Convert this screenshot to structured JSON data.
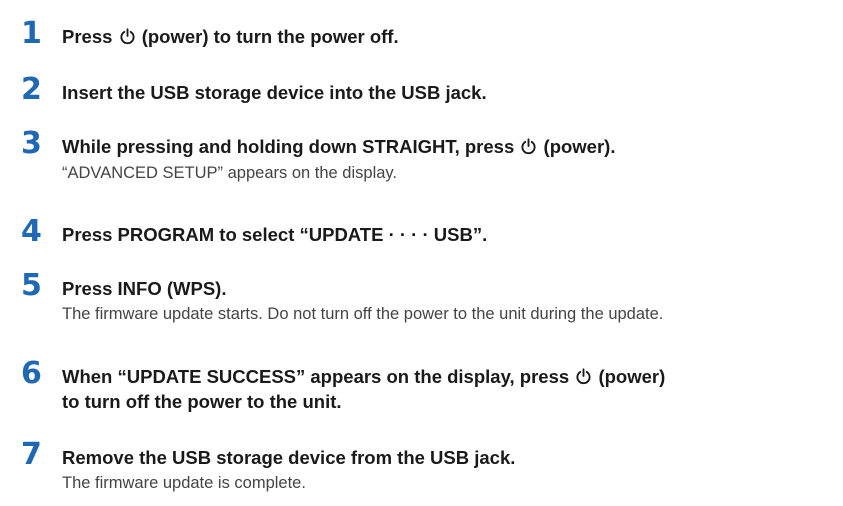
{
  "steps": [
    {
      "number": "1",
      "parts": [
        "Press ",
        "(power) to turn the power off."
      ]
    },
    {
      "number": "2",
      "title": "Insert the USB storage device into the USB jack."
    },
    {
      "number": "3",
      "parts": [
        "While pressing and holding down STRAIGHT, press ",
        "(power)."
      ],
      "description": "“ADVANCED SETUP” appears on the display."
    },
    {
      "number": "4",
      "title": "Press PROGRAM to select “UPDATE · · · · USB”."
    },
    {
      "number": "5",
      "title": "Press INFO (WPS).",
      "description": "The firmware update starts. Do not turn off the power to the unit during the update."
    },
    {
      "number": "6",
      "parts": [
        "When “UPDATE SUCCESS” appears on the display, press ",
        "(power)"
      ],
      "line2": "to turn off the power to the unit."
    },
    {
      "number": "7",
      "title": "Remove the USB storage device from the USB jack.",
      "description": "The firmware update is complete."
    }
  ],
  "icons": {
    "power": "power-icon"
  },
  "colors": {
    "step_number": "#1f69b4",
    "text": "#1a1a1a",
    "description": "#444444"
  }
}
